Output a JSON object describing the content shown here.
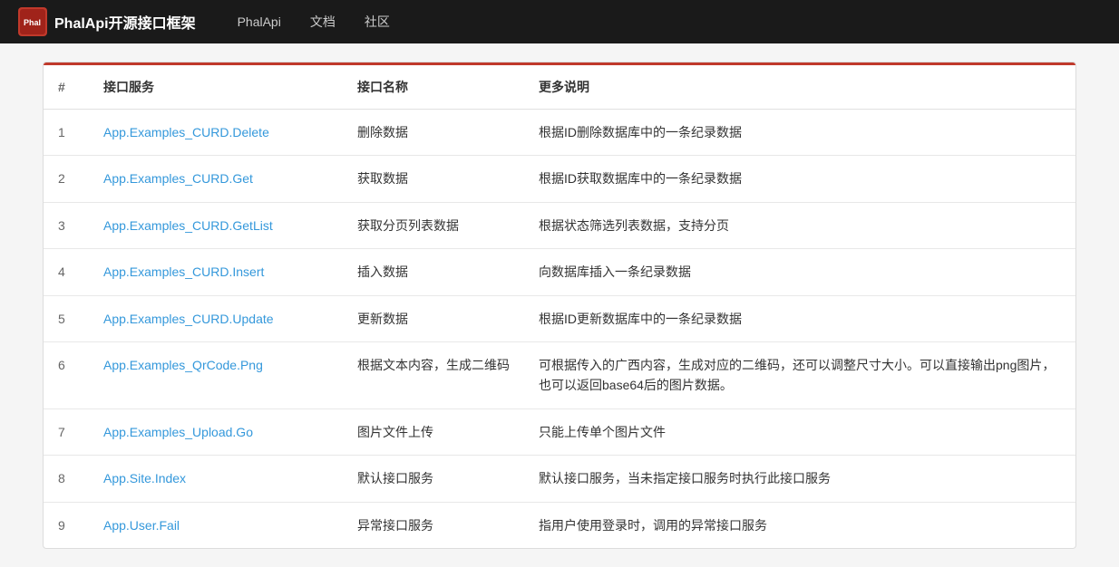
{
  "navbar": {
    "brand": "PhalApi开源接口框架",
    "logo_text": "Phal",
    "items": [
      {
        "label": "PhalApi",
        "href": "#"
      },
      {
        "label": "文档",
        "href": "#"
      },
      {
        "label": "社区",
        "href": "#"
      }
    ]
  },
  "table": {
    "headers": [
      "#",
      "接口服务",
      "接口名称",
      "更多说明"
    ],
    "rows": [
      {
        "num": "1",
        "service": "App.Examples_CURD.Delete",
        "service_href": "#",
        "name": "删除数据",
        "desc": "根据ID删除数据库中的一条纪录数据"
      },
      {
        "num": "2",
        "service": "App.Examples_CURD.Get",
        "service_href": "#",
        "name": "获取数据",
        "desc": "根据ID获取数据库中的一条纪录数据"
      },
      {
        "num": "3",
        "service": "App.Examples_CURD.GetList",
        "service_href": "#",
        "name": "获取分页列表数据",
        "desc": "根据状态筛选列表数据，支持分页"
      },
      {
        "num": "4",
        "service": "App.Examples_CURD.Insert",
        "service_href": "#",
        "name": "插入数据",
        "desc": "向数据库插入一条纪录数据"
      },
      {
        "num": "5",
        "service": "App.Examples_CURD.Update",
        "service_href": "#",
        "name": "更新数据",
        "desc": "根据ID更新数据库中的一条纪录数据"
      },
      {
        "num": "6",
        "service": "App.Examples_QrCode.Png",
        "service_href": "#",
        "name": "根据文本内容，生成二维码",
        "desc": "可根据传入的广西内容，生成对应的二维码，还可以调整尺寸大小。可以直接输出png图片，也可以返回base64后的图片数据。"
      },
      {
        "num": "7",
        "service": "App.Examples_Upload.Go",
        "service_href": "#",
        "name": "图片文件上传",
        "desc": "只能上传单个图片文件"
      },
      {
        "num": "8",
        "service": "App.Site.Index",
        "service_href": "#",
        "name": "默认接口服务",
        "desc": "默认接口服务，当未指定接口服务时执行此接口服务"
      },
      {
        "num": "9",
        "service": "App.User.Fail",
        "service_href": "#",
        "name": "异常接口服务",
        "desc": "指用户使用登录时，调用的异常接口服务"
      }
    ]
  }
}
